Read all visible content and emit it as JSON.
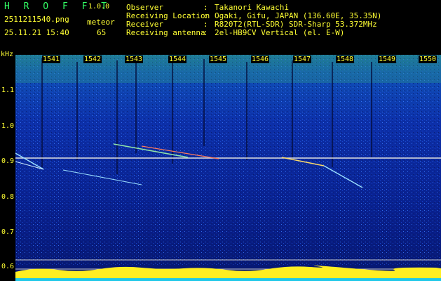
{
  "header": {
    "app_title": "H R O F F T",
    "version": "1.0.0",
    "filename": "2511211540.png",
    "meteor_label": "meteor",
    "datetime": "25.11.21 15:40",
    "meteor_count": "65",
    "info": [
      {
        "key": "Observer",
        "value": "Takanori Kawachi"
      },
      {
        "key": "Receiving Location",
        "value": "Ogaki, Gifu, JAPAN (136.60E, 35.35N)"
      },
      {
        "key": "Receiver",
        "value": "R820T2(RTL-SDR) SDR-Sharp 53.372MHz"
      },
      {
        "key": "Receiving antenna",
        "value": "2el-HB9CV Vertical (el. E-W)"
      }
    ]
  },
  "axis": {
    "unit": "kHz",
    "y_labels": [
      "1.1",
      "1.0",
      "0.9",
      "0.8",
      "0.7",
      "0.6"
    ],
    "time_labels": [
      "1541",
      "1542",
      "1543",
      "1544",
      "1545",
      "1546",
      "1547",
      "1548",
      "1549",
      "1550"
    ]
  },
  "colors": {
    "text": "#ffff33",
    "title": "#33ff66",
    "background": "#0b1f8f",
    "signal": "#ffff00"
  }
}
